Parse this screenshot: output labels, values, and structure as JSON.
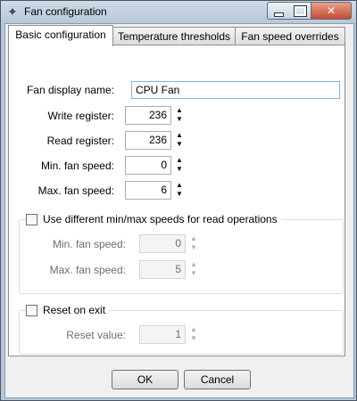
{
  "window": {
    "title": "Fan configuration",
    "app_icon": "fan-icon",
    "controls": {
      "minimize": "minimize-icon",
      "maximize": "maximize-icon",
      "close": "✕"
    }
  },
  "tabs": [
    {
      "label": "Basic configuration",
      "active": true
    },
    {
      "label": "Temperature thresholds",
      "active": false
    },
    {
      "label": "Fan speed overrides",
      "active": false
    }
  ],
  "form": {
    "display_name": {
      "label": "Fan display name:",
      "value": "CPU Fan"
    },
    "write_register": {
      "label": "Write register:",
      "value": "236"
    },
    "read_register": {
      "label": "Read register:",
      "value": "236"
    },
    "min_fan_speed": {
      "label": "Min. fan speed:",
      "value": "0"
    },
    "max_fan_speed": {
      "label": "Max. fan speed:",
      "value": "6"
    }
  },
  "read_speeds_group": {
    "checkbox_label": "Use different min/max speeds for read operations",
    "checked": false,
    "min_fan_speed": {
      "label": "Min. fan speed:",
      "value": "0"
    },
    "max_fan_speed": {
      "label": "Max. fan speed:",
      "value": "5"
    }
  },
  "reset_group": {
    "checkbox_label": "Reset on exit",
    "checked": false,
    "reset_value": {
      "label": "Reset value:",
      "value": "1"
    }
  },
  "buttons": {
    "ok": "OK",
    "cancel": "Cancel"
  }
}
